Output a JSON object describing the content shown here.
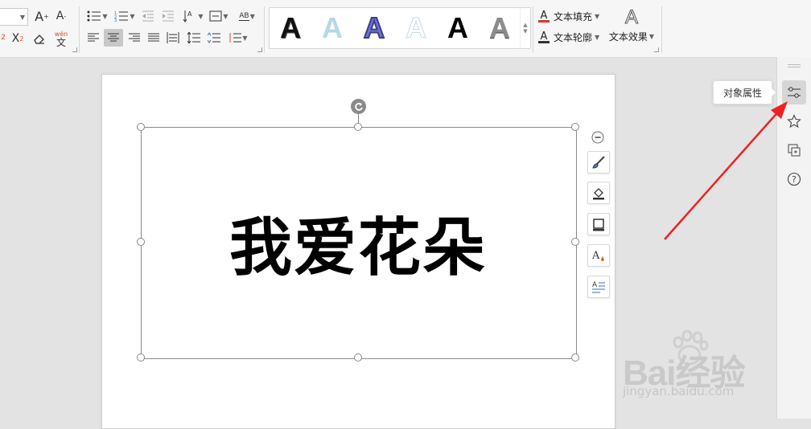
{
  "ribbon": {
    "text_fill_label": "文本填充",
    "text_outline_label": "文本轮廓",
    "text_effect_label": "文本效果",
    "phonetic_label_top": "wén",
    "phonetic_label_bottom": "文",
    "style_gallery": [
      {
        "name": "style-black-fill",
        "color": "#111111"
      },
      {
        "name": "style-light-blue-gradient",
        "color": "#b7d7e4"
      },
      {
        "name": "style-blue-outline",
        "color": "#5a5fb8"
      },
      {
        "name": "style-white-outline",
        "color": "#ffffff"
      },
      {
        "name": "style-black-plain",
        "color": "#000000"
      },
      {
        "name": "style-gray-gradient",
        "color": "#8c8c8c"
      }
    ],
    "gallery_letter": "A",
    "accent_red": "#e03232"
  },
  "document": {
    "text": "我爱花朵"
  },
  "tooltip": {
    "label": "对象属性"
  },
  "watermark": {
    "brand": "Bai经验",
    "url": "jingyan.baidu.com"
  },
  "icons": {
    "sidebar": [
      "object-properties-icon",
      "star-icon",
      "window-icon",
      "help-icon"
    ],
    "float_tools": [
      "collapse-icon",
      "brush-icon",
      "fill-icon",
      "outline-icon",
      "text-effect-icon",
      "text-wrap-icon"
    ]
  },
  "annotation_color": "#ee2222"
}
